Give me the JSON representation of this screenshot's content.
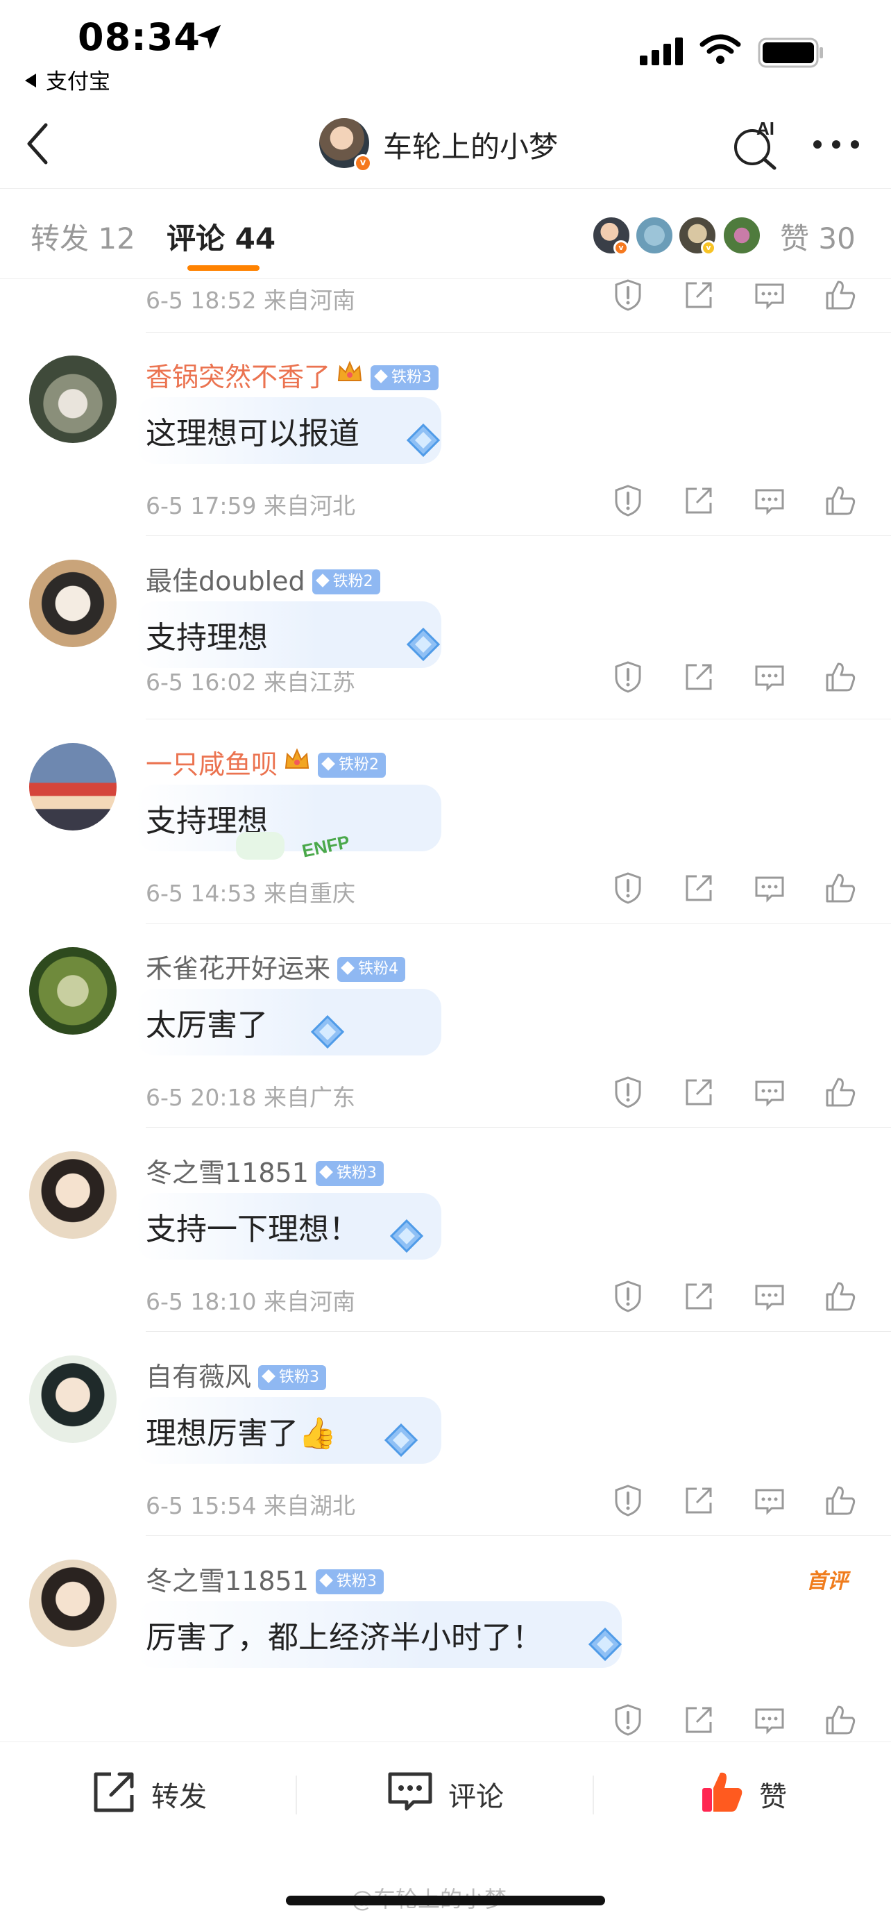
{
  "status_bar": {
    "time": "08:34",
    "back_app": "支付宝"
  },
  "nav": {
    "title": "车轮上的小梦",
    "ai_label": "AI"
  },
  "tabs": {
    "repost": "转发 12",
    "comment": "评论 44",
    "like": "赞 30",
    "accent": "#ff8200"
  },
  "partial_row": {
    "meta": "6-5 18:52  来自河南"
  },
  "comments": [
    {
      "name": "香锅突然不香了",
      "badge": "铁粉3",
      "text": "这理想可以报道",
      "meta": "6-5 17:59  来自河北",
      "vip": true
    },
    {
      "name": "最佳doubled",
      "badge": "铁粉2",
      "text": "支持理想",
      "meta": "6-5 16:02  来自江苏",
      "vip": false
    },
    {
      "name": "一只咸鱼呗",
      "badge": "铁粉2",
      "text": "支持理想",
      "meta": "6-5 14:53  来自重庆",
      "vip": true,
      "bubble_tag": "ENFP"
    },
    {
      "name": "禾雀花开好运来",
      "badge": "铁粉4",
      "text": "太厉害了",
      "meta": "6-5 20:18  来自广东",
      "vip": false
    },
    {
      "name": "冬之雪11851",
      "badge": "铁粉3",
      "text": "支持一下理想！",
      "meta": "6-5 18:10  来自河南",
      "vip": false
    },
    {
      "name": "自有薇风",
      "badge": "铁粉3",
      "text": "理想厉害了👍",
      "meta": "6-5 15:54  来自湖北",
      "vip": false
    },
    {
      "name": "冬之雪11851",
      "badge": "铁粉3",
      "text": "厉害了，都上经济半小时了！",
      "meta": "",
      "vip": false,
      "first_comment": "首评"
    }
  ],
  "bottom_bar": {
    "repost": "转发",
    "comment": "评论",
    "like": "赞"
  },
  "watermark": "@车轮上的小梦",
  "icons": [
    "location-arrow-icon",
    "signal-icon",
    "wifi-icon",
    "battery-icon",
    "back-icon",
    "ai-search-icon",
    "more-icon",
    "report-icon",
    "share-icon",
    "reply-icon",
    "like-icon",
    "diamond-icon",
    "crown-icon"
  ]
}
